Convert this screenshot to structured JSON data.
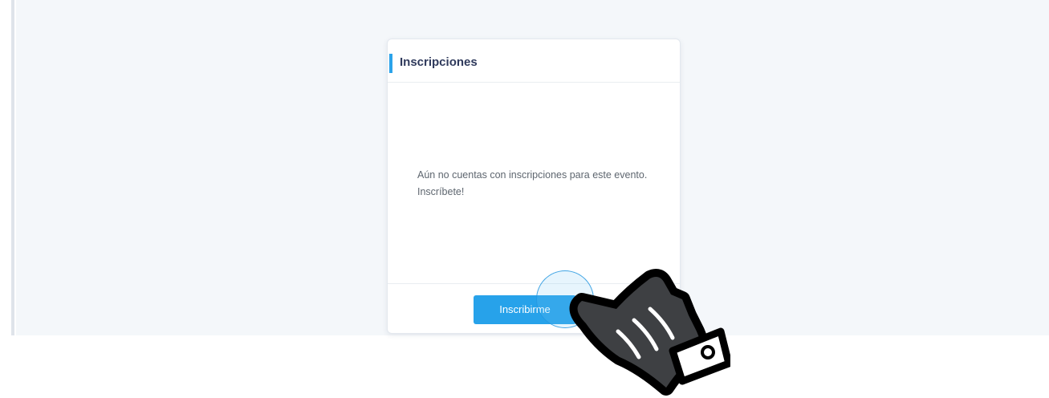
{
  "card": {
    "title": "Inscripciones",
    "empty_message": "Aún no cuentas con inscripciones para este evento. Inscríbete!",
    "button_label": "Inscribirme"
  },
  "cursor": {
    "icon": "pointing-hand-icon"
  },
  "colors": {
    "accent": "#2ba3ea",
    "button": "#27a2ea",
    "title": "#2f3a5c",
    "background": "#f4f7fa"
  }
}
